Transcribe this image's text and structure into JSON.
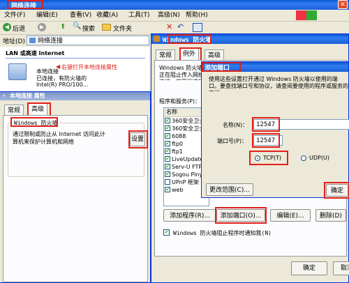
{
  "explorer": {
    "title": "网络连接",
    "menu": [
      "文件(F)",
      "编辑(E)",
      "查看(V)",
      "收藏(A)",
      "工具(T)",
      "高级(N)",
      "帮助(H)"
    ],
    "toolbar": {
      "back": "后退",
      "search": "搜索",
      "folders": "文件夹"
    },
    "address_label": "地址(D)",
    "address_value": "网络连接",
    "section_header": "LAN 或高速 Internet",
    "connection": {
      "name": "本地连接",
      "status": "已连接，有防火墙的",
      "device": "Intel(R) PRO/100..."
    },
    "annotation": "右键打开本地连接属性"
  },
  "props": {
    "title": "本地连接 属性",
    "tabs": [
      "常规",
      "高级"
    ],
    "group_title": "Windows 防火墙",
    "group_text": "通过限制或防止从 Internet 访问此计算机来保护计算机和网络",
    "settings_button": "设置"
  },
  "firewall": {
    "title": "Windows 防火墙",
    "tabs": [
      "常规",
      "例外",
      "高级"
    ],
    "intro": "Windows 防火墙正在阻止传入网络连接，下面所选的程序和服务除外。添加例外将使部分程序更好地工作，但可能增加安全风险。",
    "programs_label": "程序和服务(P)：",
    "col_name": "名称",
    "programs": [
      {
        "name": "360安全卫士",
        "checked": true
      },
      {
        "name": "360安全卫士主程序",
        "checked": true
      },
      {
        "name": "6088",
        "checked": true
      },
      {
        "name": "ftp0",
        "checked": true
      },
      {
        "name": "ftp1",
        "checked": true
      },
      {
        "name": "LiveUpdate",
        "checked": true
      },
      {
        "name": "Serv-U FTP",
        "checked": true
      },
      {
        "name": "Sogou Pinyin",
        "checked": true
      },
      {
        "name": "UPnP 框架",
        "checked": false
      },
      {
        "name": "web",
        "checked": true
      }
    ],
    "add_program": "添加程序(R)...",
    "add_port": "添加端口(O)...",
    "edit": "编辑(E)...",
    "delete": "删除(D)",
    "notify": "Windows 防火墙阻止程序时通知我(N)",
    "ok": "确定",
    "cancel": "取消"
  },
  "addport": {
    "title": "添加端口",
    "desc": "使用这些设置打开通过 Windows 防火墙以使用的端口。要查找端口号和协议，请查阅要使用的程序或服务的文档。",
    "name_label": "名称(N)：",
    "name_value": "12547",
    "port_label": "端口号(P)：",
    "port_value": "12547",
    "tcp_label": "TCP(T)",
    "udp_label": "UDP(U)",
    "protocol_selected": "TCP",
    "scope_button": "更改范围(C)...",
    "ok": "确定"
  },
  "colors": {
    "title_blue": "#0a58d6",
    "highlight_red": "#e0201a",
    "face": "#ece9d8"
  }
}
